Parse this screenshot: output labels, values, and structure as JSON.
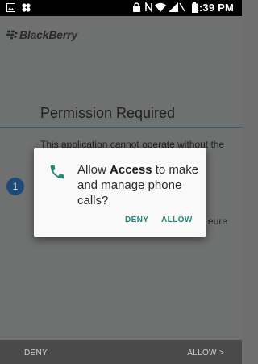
{
  "status_bar": {
    "time": "2:39 PM",
    "icons": [
      "image-icon",
      "app-icon",
      "lock-icon",
      "nfc-icon",
      "wifi-icon",
      "signal-icon",
      "no-sim-icon",
      "battery-icon"
    ]
  },
  "app": {
    "brand": "BlackBerry",
    "title": "Permission Required",
    "body_line": "This application cannot operate without the",
    "body_fragment": "eure",
    "step_number": "1"
  },
  "nav": {
    "deny_label": "DENY",
    "allow_label": "ALLOW >"
  },
  "dialog": {
    "icon": "phone-icon",
    "msg_prefix": "Allow ",
    "msg_app": "Access",
    "msg_suffix": " to make and manage phone calls?",
    "deny_label": "DENY",
    "allow_label": "ALLOW",
    "accent_color": "#1e8a7a"
  }
}
